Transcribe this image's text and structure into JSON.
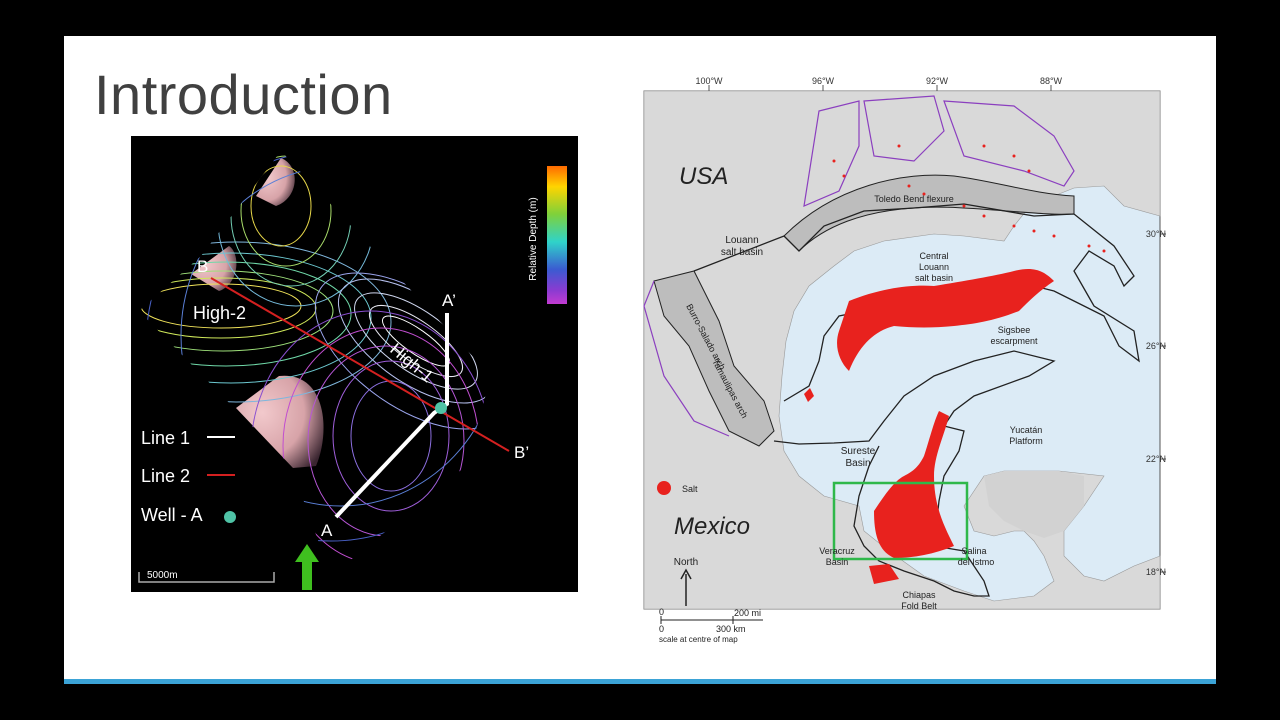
{
  "slide": {
    "title": "Introduction"
  },
  "contour_map": {
    "colorbar_label": "Relative Depth (m)",
    "labels": {
      "high_1": "High-1",
      "high_2": "High-2",
      "point_a": "A",
      "point_a_prime": "A’",
      "point_b": "B",
      "point_b_prime": "B’"
    },
    "legend": {
      "line1": "Line 1",
      "line2": "Line 2",
      "well": "Well - A"
    },
    "scale_bar": "5000m",
    "colors": {
      "line1": "#ffffff",
      "line2": "#d42020",
      "well": "#4fc3a6",
      "north_arrow": "#3fbf1f"
    }
  },
  "gulf_map": {
    "longitude_labels": [
      "100°W",
      "96°W",
      "92°W",
      "88°W"
    ],
    "latitude_labels": [
      "30°N",
      "26°N",
      "22°N",
      "18°N"
    ],
    "country_labels": {
      "usa": "USA",
      "mexico": "Mexico"
    },
    "feature_labels": {
      "toledo_bend": "Toledo Bend flexure",
      "louann_1": "Louann",
      "louann_2": "salt basin",
      "central_1": "Central",
      "central_2": "Louann",
      "central_3": "salt basin",
      "sigsbee_1": "Sigsbee",
      "sigsbee_2": "escarpment",
      "burro": "Burro-Salado arch",
      "tamaulipas": "Tamaulipas arch",
      "sureste_1": "Sureste",
      "sureste_2": "Basin",
      "yucatan_1": "Yucatán",
      "yucatan_2": "Platform",
      "veracruz_1": "Veracruz",
      "veracruz_2": "Basin",
      "salina_1": "Salina",
      "salina_2": "del Istmo",
      "chiapas_1": "Chiapas",
      "chiapas_2": "Fold Belt"
    },
    "legend": {
      "salt": "Salt"
    },
    "north_label": "North",
    "scale": {
      "zero_top": "0",
      "miles": "200 mi",
      "zero_bottom": "0",
      "km": "300 km",
      "note": "scale at centre of map"
    },
    "colors": {
      "salt": "#e8221e",
      "sea": "#dcebf6",
      "land": "#d9d9d9",
      "highlight_box": "#2fb84a"
    }
  }
}
